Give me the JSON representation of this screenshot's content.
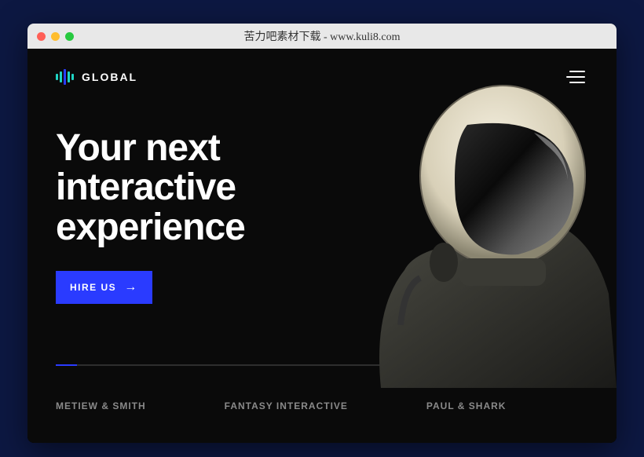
{
  "titlebar": {
    "title": "苦力吧素材下载 - www.kuli8.com"
  },
  "brand": {
    "name": "GLOBAL"
  },
  "hero": {
    "line1": "Your next",
    "line2": "interactive",
    "line3": "experience",
    "cta_label": "HIRE US"
  },
  "clients": [
    "METIEW & SMITH",
    "FANTASY INTERACTIVE",
    "PAUL & SHARK"
  ],
  "colors": {
    "accent": "#2a3bff"
  }
}
